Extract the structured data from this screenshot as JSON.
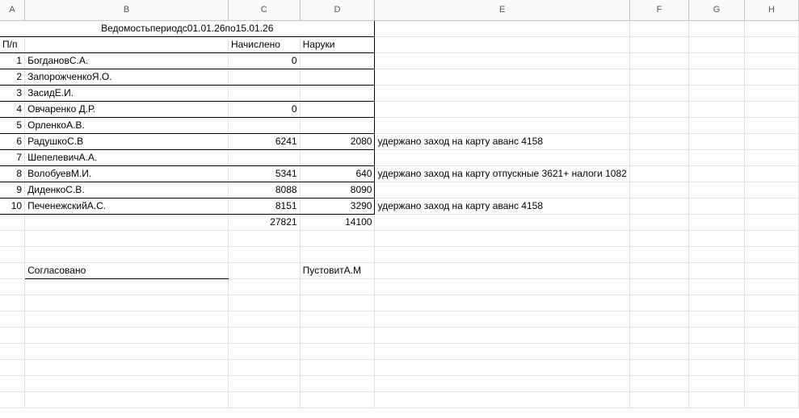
{
  "columns": [
    "A",
    "B",
    "C",
    "D",
    "E",
    "F",
    "G",
    "H"
  ],
  "title": "Ведомостьпериодс01.01.26по15.01.26",
  "headers": {
    "num": "П/п",
    "accrued": "Начислено",
    "cash": "Наруки"
  },
  "rows": [
    {
      "n": "1",
      "name": "БогдановС.А.",
      "accrued": "0",
      "cash": "",
      "note": ""
    },
    {
      "n": "2",
      "name": "ЗапорожченкоЯ.О.",
      "accrued": "",
      "cash": "",
      "note": ""
    },
    {
      "n": "3",
      "name": "ЗасидЕ.И.",
      "accrued": "",
      "cash": "",
      "note": ""
    },
    {
      "n": "4",
      "name": "Овчаренко Д.Р.",
      "accrued": "0",
      "cash": "",
      "note": ""
    },
    {
      "n": "5",
      "name": "ОрленкоА.В.",
      "accrued": "",
      "cash": "",
      "note": ""
    },
    {
      "n": "6",
      "name": "РадушкоС.В",
      "accrued": "6241",
      "cash": "2080",
      "note": "удержано  заход на карту аванс 4158"
    },
    {
      "n": "7",
      "name": "ШепелевичА.А.",
      "accrued": "",
      "cash": "",
      "note": ""
    },
    {
      "n": "8",
      "name": "ВолобуевМ.И.",
      "accrued": "5341",
      "cash": "640",
      "note": "удержано  заход на карту отпускные 3621+ налоги 1082"
    },
    {
      "n": "9",
      "name": "ДиденкоС.В.",
      "accrued": "8088",
      "cash": "8090",
      "note": ""
    },
    {
      "n": "10",
      "name": "ПеченежскийА.С.",
      "accrued": "8151",
      "cash": "3290",
      "note": "удержано  заход на карту аванс 4158"
    }
  ],
  "totals": {
    "accrued": "27821",
    "cash": "14100"
  },
  "footer": {
    "approved": "Согласовано",
    "signer": "ПустовитА.М"
  }
}
